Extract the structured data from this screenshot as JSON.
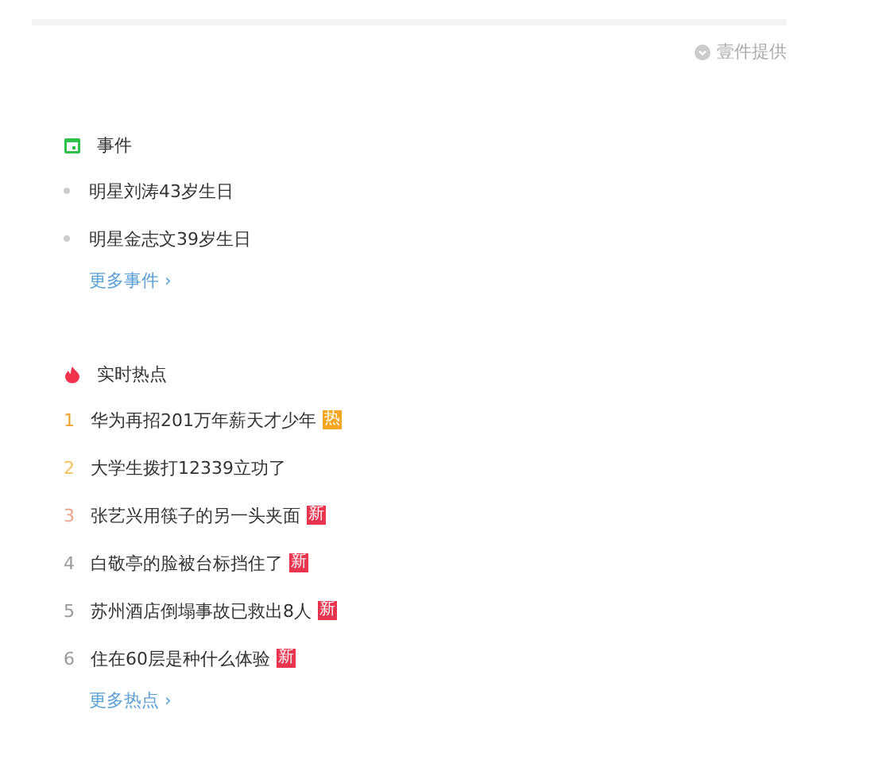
{
  "provider": {
    "text": "壹件提供"
  },
  "events": {
    "title": "事件",
    "items": [
      {
        "text": "明星刘涛43岁生日"
      },
      {
        "text": "明星金志文39岁生日"
      }
    ],
    "more": "更多事件",
    "more_arrow": "›"
  },
  "hot": {
    "title": "实时热点",
    "items": [
      {
        "rank": "1",
        "color": "#f0a02a",
        "text": "华为再招201万年薪天才少年",
        "badge": {
          "kind": "hot",
          "text": "热"
        }
      },
      {
        "rank": "2",
        "color": "#f5c060",
        "text": "大学生拨打12339立功了"
      },
      {
        "rank": "3",
        "color": "#e9a58f",
        "text": "张艺兴用筷子的另一头夹面",
        "badge": {
          "kind": "new",
          "text": "新"
        }
      },
      {
        "rank": "4",
        "color": "#999999",
        "text": "白敬亭的脸被台标挡住了",
        "badge": {
          "kind": "new",
          "text": "新"
        }
      },
      {
        "rank": "5",
        "color": "#999999",
        "text": "苏州酒店倒塌事故已救出8人",
        "badge": {
          "kind": "new",
          "text": "新"
        }
      },
      {
        "rank": "6",
        "color": "#999999",
        "text": "住在60层是种什么体验",
        "badge": {
          "kind": "new",
          "text": "新"
        }
      }
    ],
    "more": "更多热点",
    "more_arrow": "›"
  }
}
